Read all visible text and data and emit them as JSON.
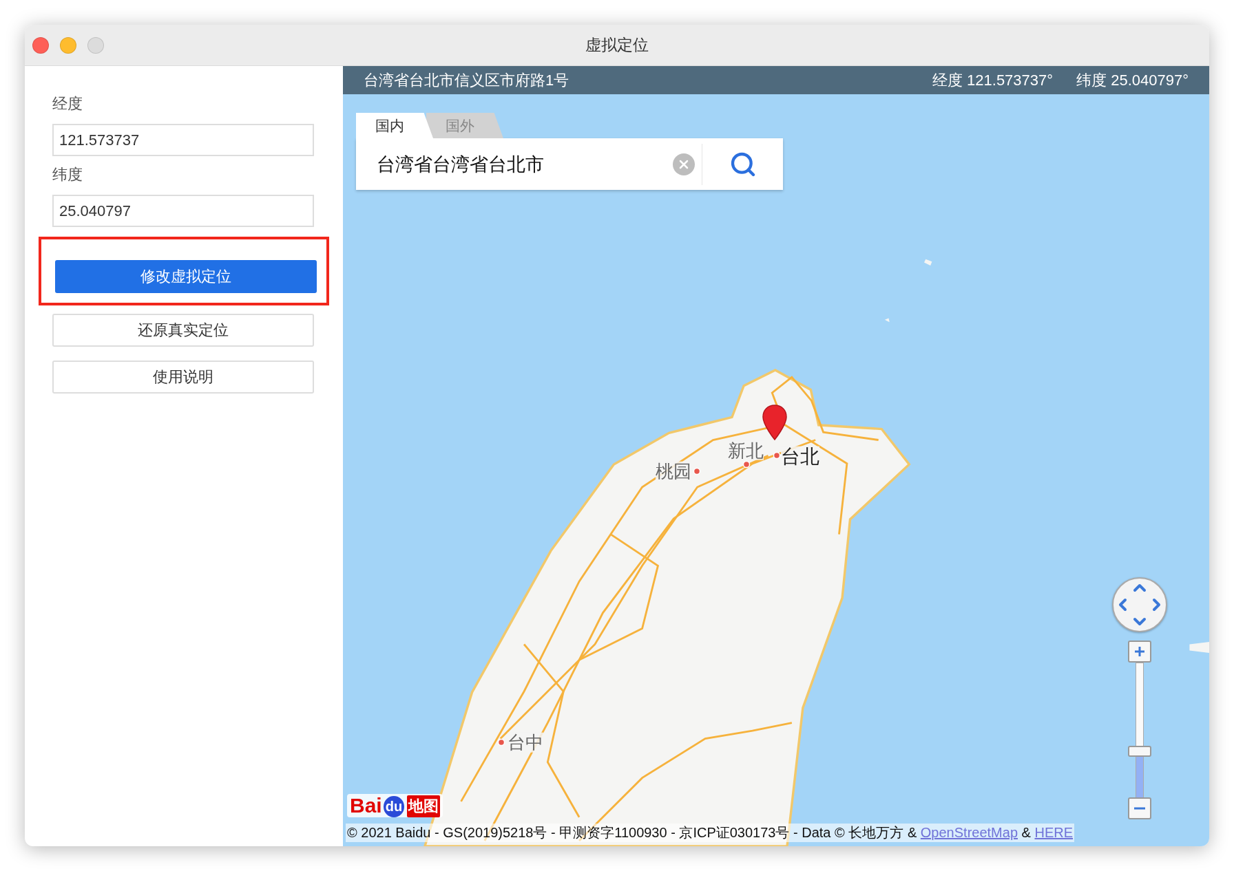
{
  "window": {
    "title": "虚拟定位"
  },
  "sidebar": {
    "fields": [
      {
        "label": "经度",
        "value": "121.573737"
      },
      {
        "label": "纬度",
        "value": "25.040797"
      }
    ],
    "buttons": [
      {
        "label": "修改虚拟定位",
        "kind": "primary",
        "highlighted": true
      },
      {
        "label": "还原真实定位",
        "kind": "default",
        "highlighted": false
      },
      {
        "label": "使用说明",
        "kind": "default",
        "highlighted": false
      }
    ]
  },
  "map": {
    "header": {
      "address": "台湾省台北市信义区市府路1号",
      "longitude": "经度 121.573737°",
      "latitude": "纬度 25.040797°"
    },
    "tabs": [
      {
        "label": "国内",
        "selected": true
      },
      {
        "label": "国外",
        "selected": false
      }
    ],
    "search": {
      "value": "台湾省台湾省台北市"
    },
    "places": [
      {
        "name": "新北",
        "major": false
      },
      {
        "name": "台北",
        "major": true
      },
      {
        "name": "桃园",
        "major": false
      },
      {
        "name": "台中",
        "major": false
      }
    ],
    "zoom": {
      "level": 0.33
    },
    "logo": {
      "text_1": "Bai",
      "text_2": "du",
      "text_3": "地图"
    },
    "attribution": {
      "text": "© 2021 Baidu - GS(2019)5218号 - 甲测资字1100930 - 京ICP证030173号 - Data © 长地万方 &",
      "link_1": "OpenStreetMap",
      "joiner": "&",
      "link_2": "HERE"
    }
  }
}
